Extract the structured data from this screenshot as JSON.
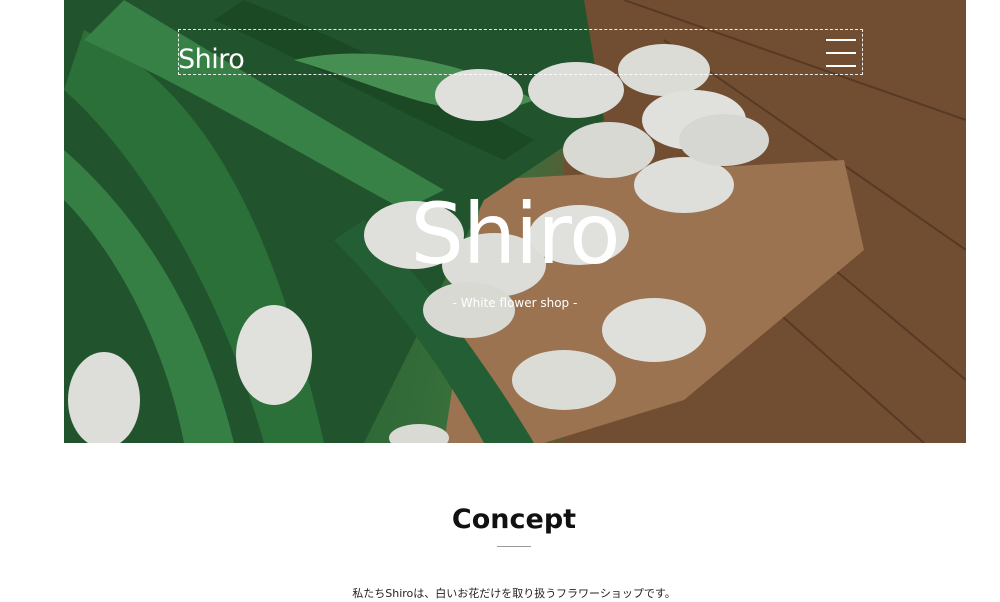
{
  "header": {
    "logo": "Shiro",
    "menu_icon": "hamburger-menu-icon"
  },
  "hero": {
    "title": "Shiro",
    "subtitle": "- White flower shop -"
  },
  "concept": {
    "title": "Concept",
    "text": "私たちShiroは、白いお花だけを取り扱うフラワーショップです。"
  },
  "colors": {
    "text_dark": "#111111",
    "text_white": "#ffffff",
    "divider": "#9a9a9a"
  }
}
